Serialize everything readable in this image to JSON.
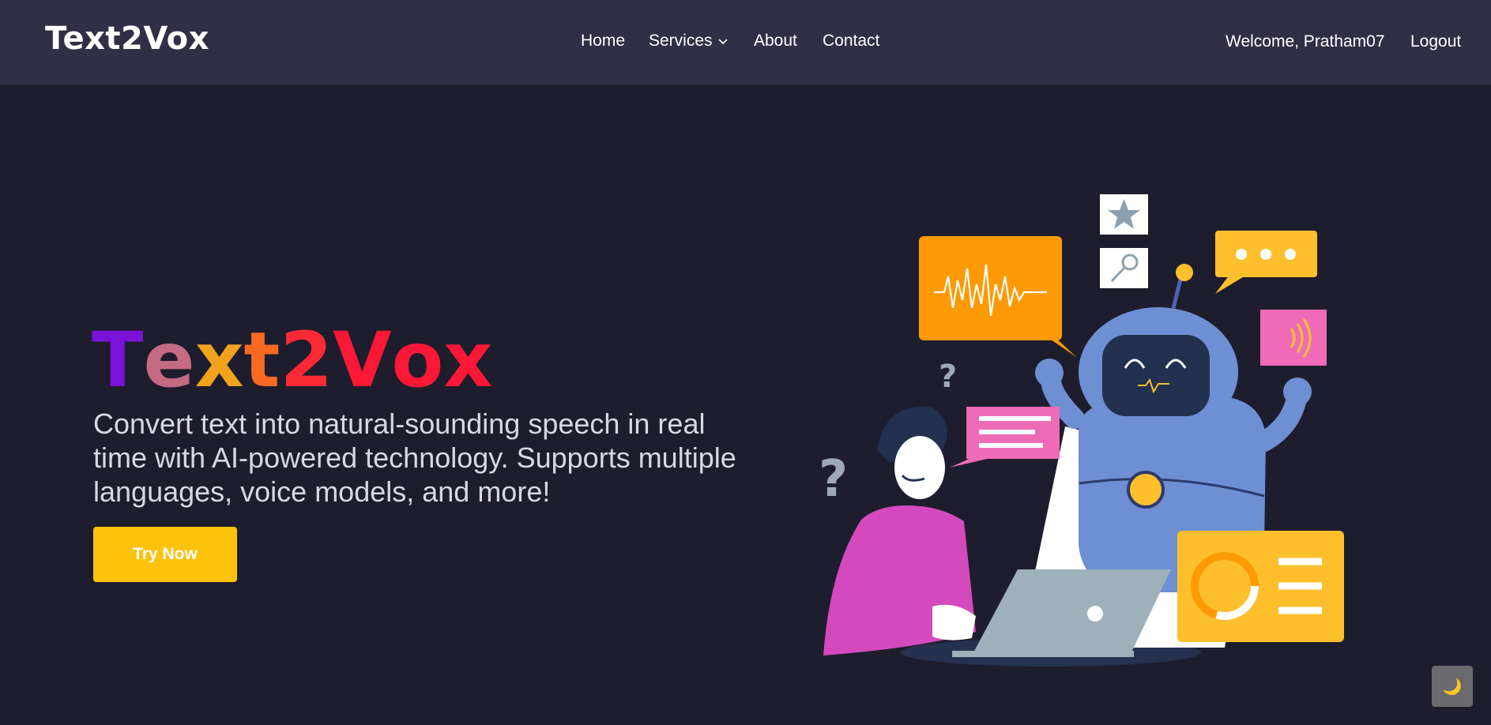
{
  "nav": {
    "brand": "Text2Vox",
    "links": [
      {
        "label": "Home"
      },
      {
        "label": "Services"
      },
      {
        "label": "About"
      },
      {
        "label": "Contact"
      }
    ],
    "welcome": "Welcome, Pratham07",
    "logout": "Logout"
  },
  "hero": {
    "title_letters": [
      "T",
      "e",
      "x",
      "t",
      "2",
      "V",
      "o",
      "x"
    ],
    "title_colors": [
      "#7b12d8",
      "#c46a82",
      "#f2a31c",
      "#f86a22",
      "#fa2a35",
      "#fb1736",
      "#fb1736",
      "#fb1736"
    ],
    "description": "Convert text into natural-sounding speech in real time with AI-powered technology. Supports multiple languages, voice models, and more!",
    "cta_label": "Try Now"
  },
  "theme_toggle": {
    "icon": "moon-icon",
    "glyph": "🌙"
  },
  "colors": {
    "background": "#1e1d2d",
    "navbar": "#302f45",
    "accent": "#fdc20c"
  }
}
